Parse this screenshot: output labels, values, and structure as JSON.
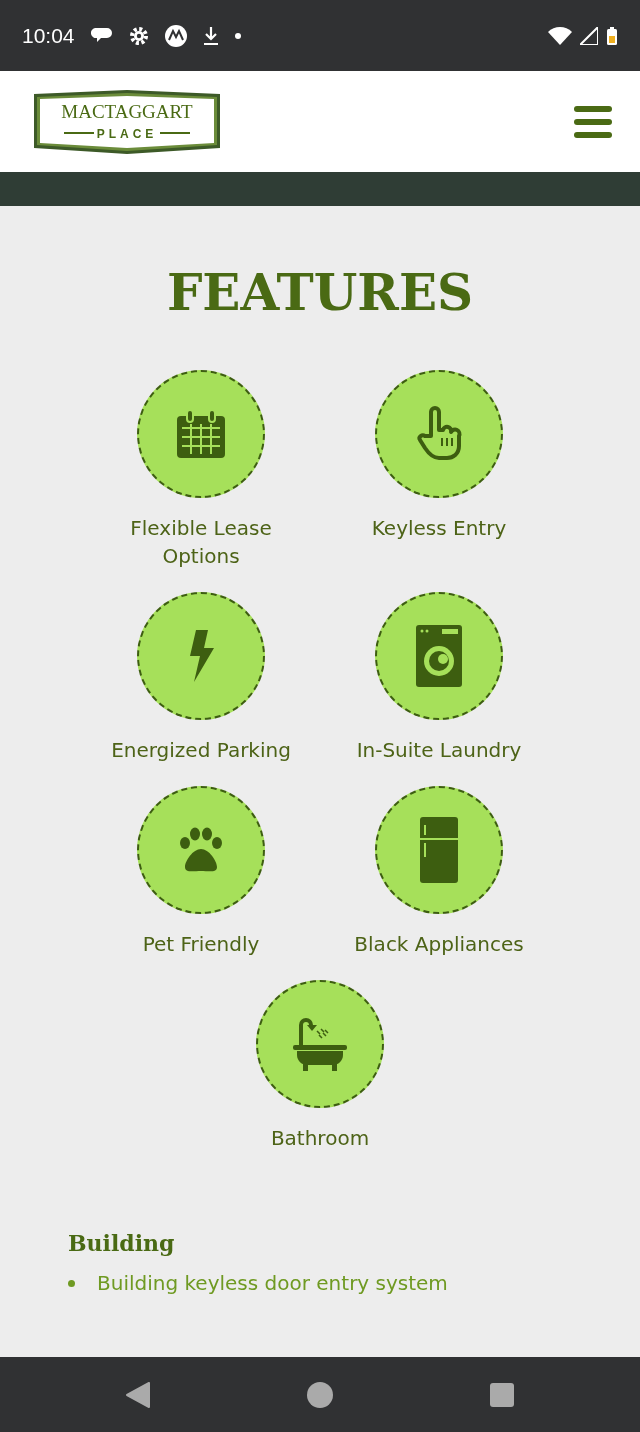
{
  "status_bar": {
    "time": "10:04"
  },
  "header": {
    "logo": {
      "title": "MACTAGGART",
      "subtitle": "PLACE"
    }
  },
  "features": {
    "title": "FEATURES",
    "items": [
      {
        "label": "Flexible Lease Options"
      },
      {
        "label": "Keyless Entry"
      },
      {
        "label": "Energized Parking"
      },
      {
        "label": "In-Suite Laundry"
      },
      {
        "label": "Pet Friendly"
      },
      {
        "label": "Black Appliances"
      },
      {
        "label": "Bathroom"
      }
    ]
  },
  "building": {
    "heading": "Building",
    "items": [
      "Building keyless door entry system"
    ]
  }
}
